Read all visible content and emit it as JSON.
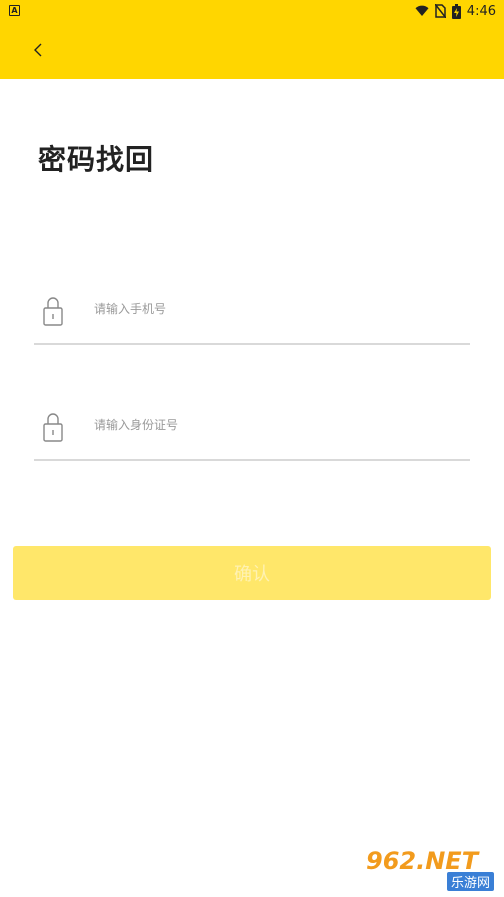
{
  "status_bar": {
    "notification_letter": "A",
    "time": "4:46",
    "icons": [
      "wifi-icon",
      "no-sim-icon",
      "battery-charging-icon"
    ]
  },
  "header": {
    "back_icon": "chevron-left-icon"
  },
  "page": {
    "title": "密码找回"
  },
  "form": {
    "phone": {
      "value": "",
      "placeholder": "请输入手机号",
      "icon": "lock-icon"
    },
    "id_number": {
      "value": "",
      "placeholder": "请输入身份证号",
      "icon": "lock-icon"
    },
    "confirm_label": "确认"
  },
  "colors": {
    "brand_yellow": "#ffd600",
    "button_disabled": "#ffe76a",
    "divider": "#d9d9d9",
    "placeholder": "#9a9a9a"
  },
  "watermark": {
    "main": "962.NET",
    "sub": "乐游网"
  }
}
